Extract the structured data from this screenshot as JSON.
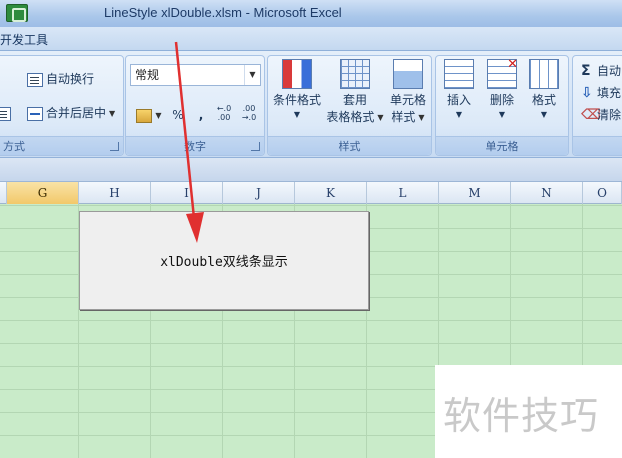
{
  "window": {
    "title": "LineStyle xlDouble.xlsm - Microsoft Excel",
    "app_icon": "excel-icon"
  },
  "tabs": {
    "developer": "开发工具"
  },
  "ribbon": {
    "alignment": {
      "wrap_text": "自动换行",
      "merge_center": "合并后居中",
      "label": "方式"
    },
    "number": {
      "format_value": "常规",
      "percent": "%",
      "comma": ",",
      "inc_decimal": "←.0\n.00",
      "dec_decimal": ".00\n→.0",
      "label": "数字"
    },
    "styles": {
      "conditional_format": "条件格式",
      "table_format_line1": "套用",
      "table_format_line2": "表格格式",
      "cell_style_line1": "单元格",
      "cell_style_line2": "样式",
      "label": "样式"
    },
    "cells": {
      "insert": "插入",
      "delete": "删除",
      "format": "格式",
      "label": "单元格"
    },
    "editing": {
      "autosum": "自动",
      "fill": "填充",
      "clear": "清除"
    }
  },
  "columns": [
    "G",
    "H",
    "I",
    "J",
    "K",
    "L",
    "M",
    "N",
    "O"
  ],
  "selected_column": "G",
  "sheet_button": {
    "label": "xlDouble双线条显示"
  },
  "annotation": {
    "arrow_color": "#e03030"
  },
  "watermark": {
    "text": "软件技巧"
  }
}
